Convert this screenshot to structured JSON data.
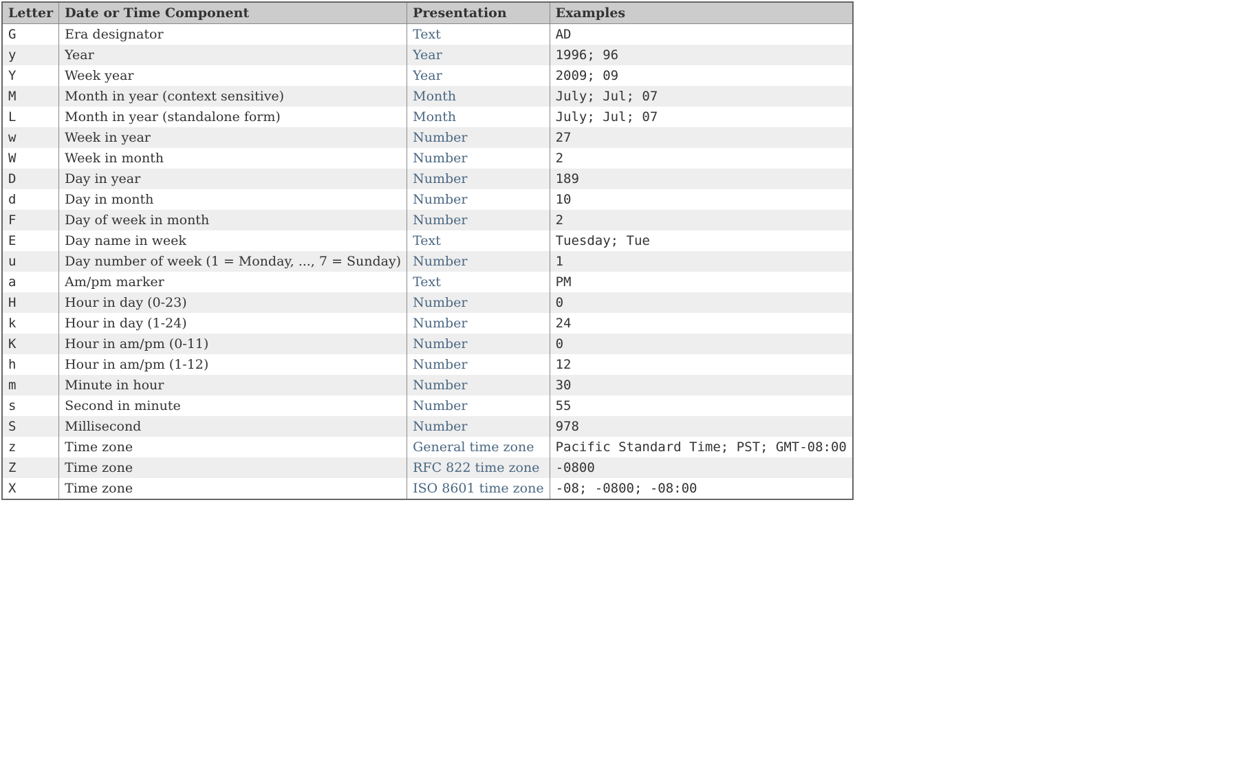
{
  "headers": {
    "letter": "Letter",
    "component": "Date or Time Component",
    "presentation": "Presentation",
    "examples": "Examples"
  },
  "rows": [
    {
      "letter": "G",
      "component": "Era designator",
      "presentation": "Text",
      "examples": "AD"
    },
    {
      "letter": "y",
      "component": "Year",
      "presentation": "Year",
      "examples": "1996; 96"
    },
    {
      "letter": "Y",
      "component": "Week year",
      "presentation": "Year",
      "examples": "2009; 09"
    },
    {
      "letter": "M",
      "component": "Month in year (context sensitive)",
      "presentation": "Month",
      "examples": "July; Jul; 07"
    },
    {
      "letter": "L",
      "component": "Month in year (standalone form)",
      "presentation": "Month",
      "examples": "July; Jul; 07"
    },
    {
      "letter": "w",
      "component": "Week in year",
      "presentation": "Number",
      "examples": "27"
    },
    {
      "letter": "W",
      "component": "Week in month",
      "presentation": "Number",
      "examples": "2"
    },
    {
      "letter": "D",
      "component": "Day in year",
      "presentation": "Number",
      "examples": "189"
    },
    {
      "letter": "d",
      "component": "Day in month",
      "presentation": "Number",
      "examples": "10"
    },
    {
      "letter": "F",
      "component": "Day of week in month",
      "presentation": "Number",
      "examples": "2"
    },
    {
      "letter": "E",
      "component": "Day name in week",
      "presentation": "Text",
      "examples": "Tuesday; Tue"
    },
    {
      "letter": "u",
      "component": "Day number of week (1 = Monday, ..., 7 = Sunday)",
      "presentation": "Number",
      "examples": "1"
    },
    {
      "letter": "a",
      "component": "Am/pm marker",
      "presentation": "Text",
      "examples": "PM"
    },
    {
      "letter": "H",
      "component": "Hour in day (0-23)",
      "presentation": "Number",
      "examples": "0"
    },
    {
      "letter": "k",
      "component": "Hour in day (1-24)",
      "presentation": "Number",
      "examples": "24"
    },
    {
      "letter": "K",
      "component": "Hour in am/pm (0-11)",
      "presentation": "Number",
      "examples": "0"
    },
    {
      "letter": "h",
      "component": "Hour in am/pm (1-12)",
      "presentation": "Number",
      "examples": "12"
    },
    {
      "letter": "m",
      "component": "Minute in hour",
      "presentation": "Number",
      "examples": "30"
    },
    {
      "letter": "s",
      "component": "Second in minute",
      "presentation": "Number",
      "examples": "55"
    },
    {
      "letter": "S",
      "component": "Millisecond",
      "presentation": "Number",
      "examples": "978"
    },
    {
      "letter": "z",
      "component": "Time zone",
      "presentation": "General time zone",
      "examples": "Pacific Standard Time; PST; GMT-08:00"
    },
    {
      "letter": "Z",
      "component": "Time zone",
      "presentation": "RFC 822 time zone",
      "examples": "-0800"
    },
    {
      "letter": "X",
      "component": "Time zone",
      "presentation": "ISO 8601 time zone",
      "examples": "-08; -0800; -08:00"
    }
  ]
}
